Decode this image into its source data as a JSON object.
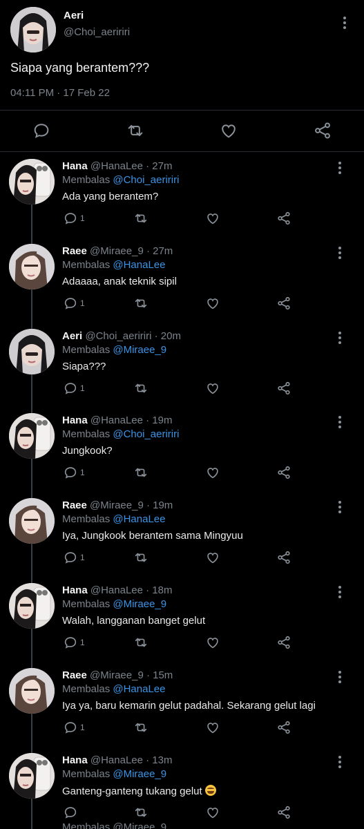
{
  "main_tweet": {
    "name": "Aeri",
    "handle": "@Choi_aeririri",
    "text": "Siapa yang berantem???",
    "time": "04:11 PM · 17 Feb 22"
  },
  "replying_prefix": "Membalas",
  "replies": [
    {
      "avatar": "hana",
      "name": "Hana",
      "meta": "@HanaLee · 27m",
      "mention": "@Choi_aeririri",
      "text": "Ada yang berantem?",
      "count": "1"
    },
    {
      "avatar": "raee",
      "name": "Raee",
      "meta": "@Miraee_9 · 27m",
      "mention": "@HanaLee",
      "text": "Adaaaa, anak teknik sipil",
      "count": "1"
    },
    {
      "avatar": "aeri",
      "name": "Aeri",
      "meta": "@Choi_aeririri · 20m",
      "mention": "@Miraee_9",
      "text": "Siapa???",
      "count": "1"
    },
    {
      "avatar": "hana",
      "name": "Hana",
      "meta": "@HanaLee · 19m",
      "mention": "@Choi_aeririri",
      "text": "Jungkook?",
      "count": "1"
    },
    {
      "avatar": "raee",
      "name": "Raee",
      "meta": "@Miraee_9 · 19m",
      "mention": "@HanaLee",
      "text": "Iya, Jungkook berantem sama Mingyuu",
      "count": "1"
    },
    {
      "avatar": "hana",
      "name": "Hana",
      "meta": "@HanaLee · 18m",
      "mention": "@Miraee_9",
      "text": "Walah, langganan banget gelut",
      "count": "1"
    },
    {
      "avatar": "raee",
      "name": "Raee",
      "meta": "@Miraee_9 · 15m",
      "mention": "@HanaLee",
      "text": "Iya ya, baru kemarin gelut padahal. Sekarang gelut lagi",
      "count": "1"
    },
    {
      "avatar": "hana",
      "name": "Hana",
      "meta": "@HanaLee · 13m",
      "mention": "@Miraee_9",
      "text": "Ganteng-ganteng tukang gelut",
      "emoji": "grinning-sweat-emoji",
      "count": ""
    }
  ],
  "partial_line": "Membalas @Miraee_9",
  "icons": [
    "reply-icon",
    "retweet-icon",
    "like-icon",
    "share-icon",
    "more-icon"
  ],
  "colors": {
    "background": "#000000",
    "mention": "#3b94e6",
    "muted": "#7b838b",
    "icon": "#8b929a"
  }
}
